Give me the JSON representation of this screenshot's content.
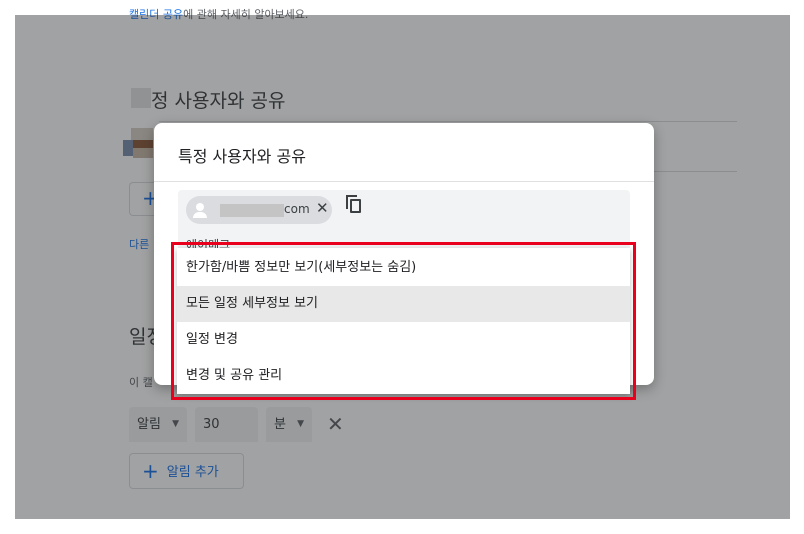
{
  "background": {
    "help_link": "캘린더 공유",
    "help_suffix": "에 관해 자세히 알아보세요.",
    "share_section_title": "정 사용자와 공유",
    "learn_more_fragment": "다른",
    "events_section_fragment": "일정",
    "events_desc_fragment": "이 캘",
    "alert": {
      "type": "알림",
      "amount": "30",
      "unit": "분",
      "add_label": "알림 추가"
    }
  },
  "dialog": {
    "title": "특정 사용자와 공유",
    "chip_email_suffix": "com",
    "input_label_fragment": "에이메크",
    "permission_options": [
      "한가함/바쁨 정보만 보기(세부정보는 숨김)",
      "모든 일정 세부정보 보기",
      "일정 변경",
      "변경 및 공유 관리"
    ],
    "selected_index": 1
  },
  "icons": {
    "chip_avatar": "person-icon",
    "chip_remove": "close-icon",
    "copy": "copy-icon",
    "add": "plus-icon",
    "dropdown": "caret-down-icon",
    "remove_alert": "close-icon"
  },
  "colors": {
    "accent": "#1a73e8",
    "annotation": "#e8001c",
    "selected_row": "#e8e8e8"
  }
}
